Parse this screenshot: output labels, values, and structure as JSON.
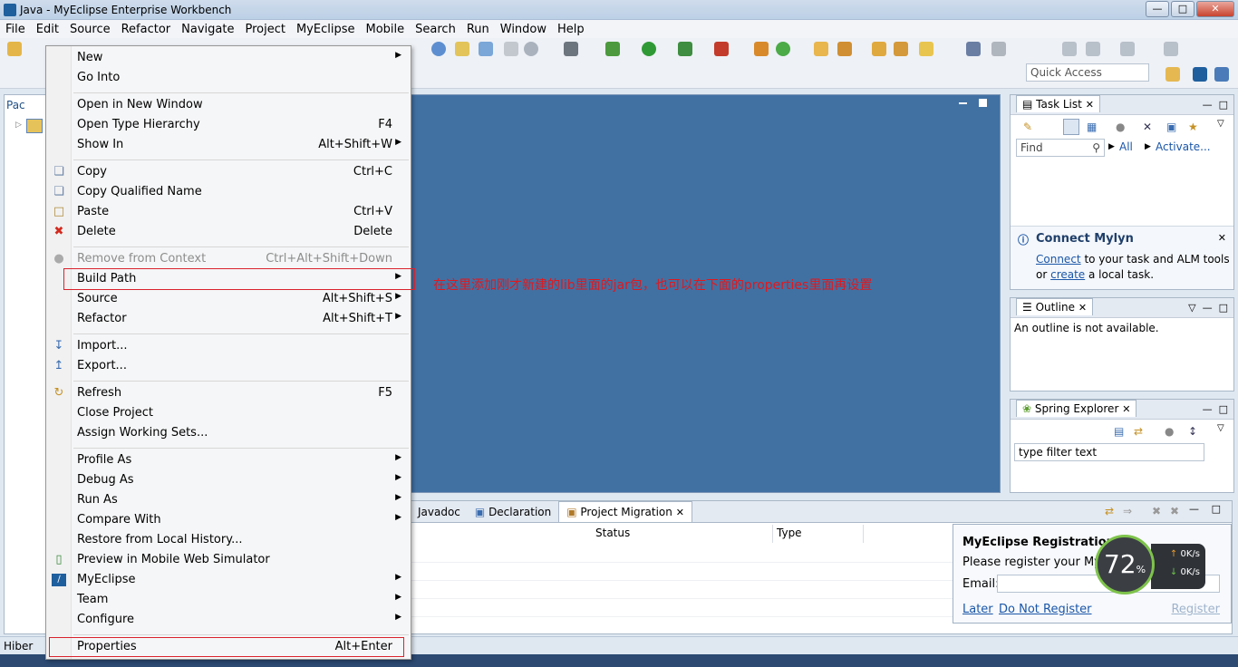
{
  "window": {
    "title": "Java - MyEclipse Enterprise Workbench"
  },
  "menubar": [
    "File",
    "Edit",
    "Source",
    "Refactor",
    "Navigate",
    "Project",
    "MyEclipse",
    "Mobile",
    "Search",
    "Run",
    "Window",
    "Help"
  ],
  "quick_access": "Quick Access",
  "left_pane": {
    "tab": "Pac"
  },
  "context_menu": {
    "new": "New",
    "go_into": "Go Into",
    "open_new_window": "Open in New Window",
    "open_type_hierarchy": "Open Type Hierarchy",
    "open_type_hierarchy_sc": "F4",
    "show_in": "Show In",
    "show_in_sc": "Alt+Shift+W",
    "copy": "Copy",
    "copy_sc": "Ctrl+C",
    "copy_qualified": "Copy Qualified Name",
    "paste": "Paste",
    "paste_sc": "Ctrl+V",
    "delete": "Delete",
    "delete_sc": "Delete",
    "remove_context": "Remove from Context",
    "remove_context_sc": "Ctrl+Alt+Shift+Down",
    "build_path": "Build Path",
    "source": "Source",
    "source_sc": "Alt+Shift+S",
    "refactor": "Refactor",
    "refactor_sc": "Alt+Shift+T",
    "import": "Import...",
    "export": "Export...",
    "refresh": "Refresh",
    "refresh_sc": "F5",
    "close_project": "Close Project",
    "assign_working_sets": "Assign Working Sets...",
    "profile_as": "Profile As",
    "debug_as": "Debug As",
    "run_as": "Run As",
    "compare_with": "Compare With",
    "restore_history": "Restore from Local History...",
    "preview_mobile": "Preview in Mobile Web Simulator",
    "myeclipse": "MyEclipse",
    "team": "Team",
    "configure": "Configure",
    "properties": "Properties",
    "properties_sc": "Alt+Enter"
  },
  "annotation": "在这里添加刚才新建的lib里面的jar包，也可以在下面的properties里面再设置",
  "bottom": {
    "tabs": [
      "Javadoc",
      "Declaration",
      "Project Migration"
    ],
    "columns": [
      "Status",
      "Type"
    ]
  },
  "task_list": {
    "title": "Task List",
    "find": "Find",
    "all": "All",
    "activate": "Activate...",
    "mylyn_title": "Connect Mylyn",
    "mylyn_connect": "Connect",
    "mylyn_text1": " to your task and ALM tools",
    "mylyn_or": "or ",
    "mylyn_create": "create",
    "mylyn_text2": " a local task."
  },
  "outline": {
    "title": "Outline",
    "message": "An outline is not available."
  },
  "spring": {
    "title": "Spring Explorer",
    "filter": "type filter text"
  },
  "registration": {
    "title": "MyEclipse Registration",
    "message": "Please register your MyEclipse",
    "email_label": "Email:",
    "later": "Later",
    "do_not_register": "Do Not Register",
    "register": "Register"
  },
  "gadget": {
    "percent": "72",
    "percent_sign": "%",
    "up": "0K/s",
    "down": "0K/s"
  },
  "status": {
    "text": "Hiber"
  },
  "colors": {
    "editor_bg": "#4171a3",
    "annotation": "#e0181e",
    "link": "#1a56a8"
  }
}
